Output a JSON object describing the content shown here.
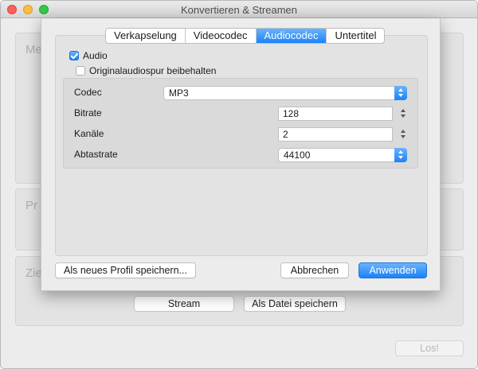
{
  "window": {
    "title": "Konvertieren & Streamen",
    "background_groups": [
      {
        "label": "Me"
      },
      {
        "label": "Pr"
      },
      {
        "label": "Zie"
      }
    ],
    "stream_button": "Stream",
    "save_file_button": "Als Datei speichern",
    "go_button": "Los!"
  },
  "sheet": {
    "tabs": [
      {
        "label": "Verkapselung",
        "active": false
      },
      {
        "label": "Videocodec",
        "active": false
      },
      {
        "label": "Audiocodec",
        "active": true
      },
      {
        "label": "Untertitel",
        "active": false
      }
    ],
    "audio_checkbox": {
      "label": "Audio",
      "checked": true
    },
    "keep_original_checkbox": {
      "label": "Originalaudiospur beibehalten",
      "checked": false
    },
    "fields": {
      "codec": {
        "label": "Codec",
        "value": "MP3"
      },
      "bitrate": {
        "label": "Bitrate",
        "value": "128"
      },
      "channels": {
        "label": "Kanäle",
        "value": "2"
      },
      "samplerate": {
        "label": "Abtastrate",
        "value": "44100"
      }
    },
    "save_profile_button": "Als neues Profil speichern...",
    "cancel_button": "Abbrechen",
    "apply_button": "Anwenden"
  },
  "colors": {
    "accent": "#1a82fb",
    "window_bg": "#ececec"
  }
}
